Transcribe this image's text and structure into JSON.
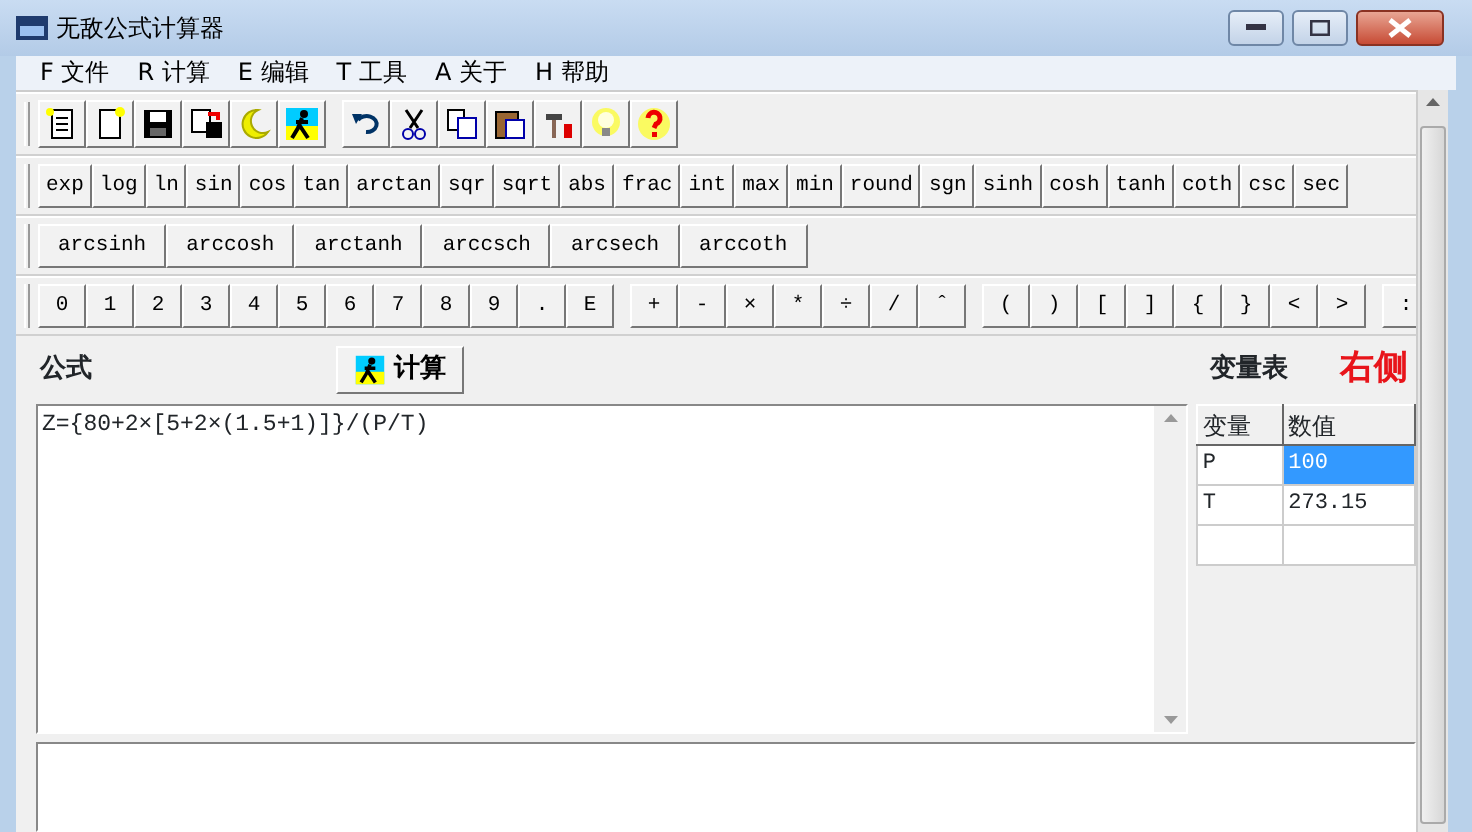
{
  "window": {
    "title": "无敌公式计算器"
  },
  "menu": [
    "F 文件",
    "R 计算",
    "E 编辑",
    "T 工具",
    "A 关于",
    "H 帮助"
  ],
  "function_rows": [
    [
      "exp",
      "log",
      "ln",
      "sin",
      "cos",
      "tan",
      "arctan",
      "sqr",
      "sqrt",
      "abs",
      "frac",
      "int",
      "max",
      "min",
      "round",
      "sgn",
      "sinh",
      "cosh",
      "tanh",
      "coth",
      "csc",
      "sec"
    ],
    [
      "arcsinh",
      "arccosh",
      "arctanh",
      "arccsch",
      "arcsech",
      "arccoth"
    ]
  ],
  "key_groups": [
    [
      "0",
      "1",
      "2",
      "3",
      "4",
      "5",
      "6",
      "7",
      "8",
      "9",
      ".",
      "E"
    ],
    [
      "+",
      "-",
      "×",
      "*",
      "÷",
      "/",
      "ˆ"
    ],
    [
      "(",
      ")",
      "[",
      "]",
      "{",
      "}",
      "<",
      ">"
    ],
    [
      ":"
    ]
  ],
  "formula_label": "公式",
  "compute_button": "计算",
  "variables_label": "变量表",
  "annotation": "右侧",
  "formula_text": "Z={80+2×[5+2×(1.5+1)]}/(P/T)",
  "variables": {
    "columns": [
      "变量",
      "数值"
    ],
    "rows": [
      {
        "name": "P",
        "value": "100",
        "selected": true
      },
      {
        "name": "T",
        "value": "273.15",
        "selected": false
      }
    ]
  }
}
